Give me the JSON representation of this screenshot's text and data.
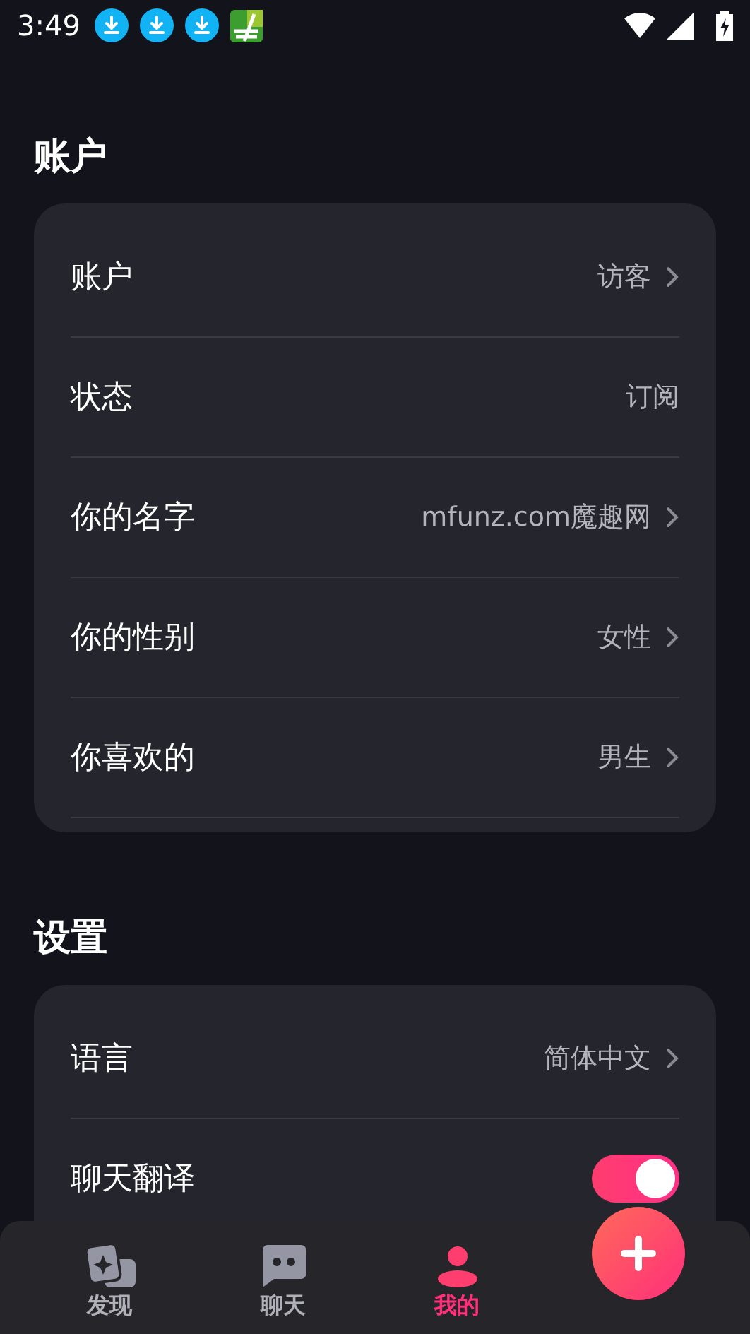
{
  "status_bar": {
    "time": "3:49"
  },
  "sections": [
    {
      "title": "账户",
      "rows": [
        {
          "kind": "link",
          "label": "账户",
          "value": "访客"
        },
        {
          "kind": "value",
          "label": "状态",
          "value": "订阅"
        },
        {
          "kind": "link",
          "label": "你的名字",
          "value": "mfunz.com魔趣网"
        },
        {
          "kind": "link",
          "label": "你的性别",
          "value": "女性"
        },
        {
          "kind": "link",
          "label": "你喜欢的",
          "value": "男生"
        }
      ]
    },
    {
      "title": "设置",
      "rows": [
        {
          "kind": "link",
          "label": "语言",
          "value": "简体中文"
        },
        {
          "kind": "toggle",
          "label": "聊天翻译",
          "on": true
        }
      ]
    }
  ],
  "bottom_nav": [
    {
      "kind": "discover",
      "label": "发现",
      "selected": false
    },
    {
      "kind": "chat",
      "label": "聊天",
      "selected": false
    },
    {
      "kind": "me",
      "label": "我的",
      "selected": true
    }
  ]
}
